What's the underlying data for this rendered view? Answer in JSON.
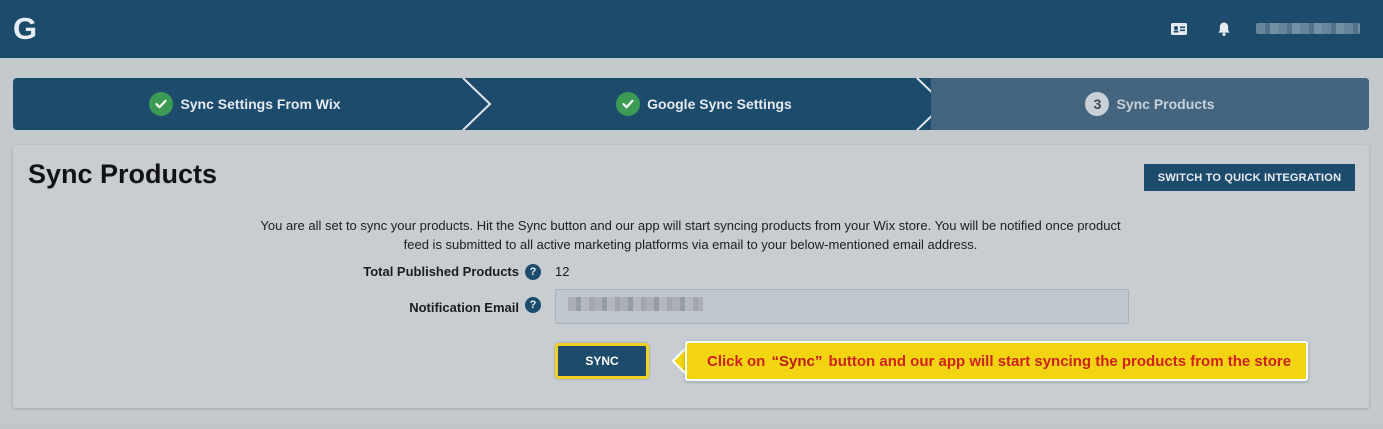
{
  "header": {
    "logo_letter": "G",
    "icons": [
      "profile-card-icon",
      "bell-icon"
    ]
  },
  "stepper": {
    "steps": [
      {
        "label": "Sync Settings From Wix",
        "status": "done"
      },
      {
        "label": "Google Sync Settings",
        "status": "done"
      },
      {
        "number": "3",
        "label": "Sync Products",
        "status": "current"
      }
    ]
  },
  "main": {
    "title": "Sync Products",
    "quick_integration_label": "SWITCH TO QUICK INTEGRATION",
    "description": "You are all set to sync your products. Hit the Sync button and our app will start syncing products from your Wix store. You will be notified once product feed is submitted to all active marketing platforms via email to your below-mentioned email address.",
    "total_label": "Total Published Products",
    "total_value": "12",
    "email_label": "Notification Email",
    "help_glyph": "?",
    "sync_label": "SYNC"
  },
  "callout": {
    "prefix": "Click on ",
    "highlight": "“Sync”",
    "suffix": " button and our app will start syncing the products from the store"
  },
  "colors": {
    "primary": "#1c4b6c",
    "success": "#3b9a54",
    "callout_bg": "#f2d411",
    "callout_text": "#d1211b",
    "highlight_border": "#f3d21f"
  }
}
